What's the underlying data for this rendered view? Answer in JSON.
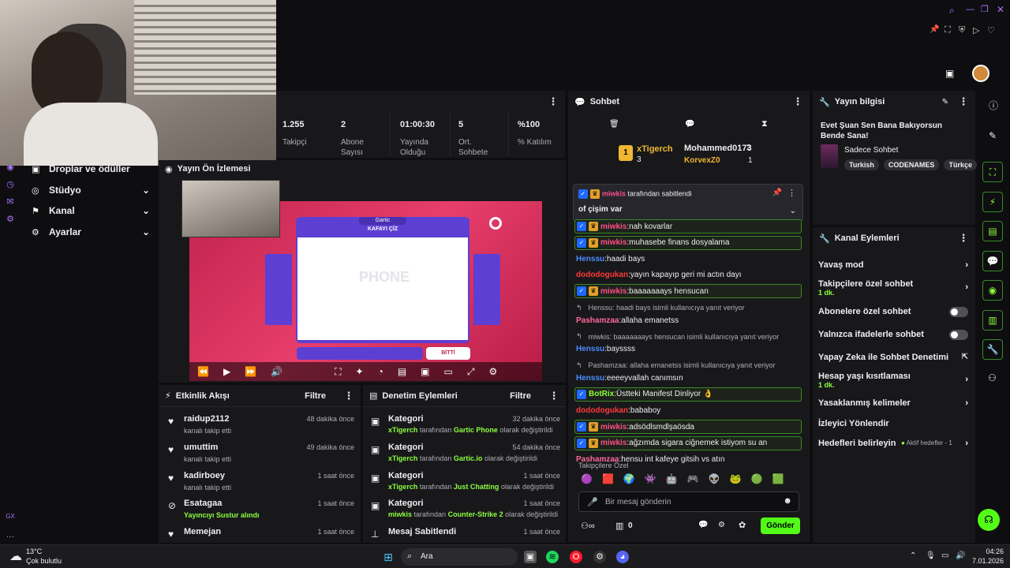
{
  "stats": [
    {
      "value": "1.255",
      "label": "Takipçi"
    },
    {
      "value": "2",
      "label": "Abone Sayısı"
    },
    {
      "value": "01:00:30",
      "label": "Yayında Olduğu"
    },
    {
      "value": "5",
      "label": "Ort. Sohbete"
    },
    {
      "value": "%100",
      "label": "% Katılım"
    }
  ],
  "nav": {
    "drops": "Droplar ve ödüller",
    "studio": "Stüdyo",
    "channel": "Kanal",
    "settings": "Ayarlar",
    "gx": "GX"
  },
  "preview": {
    "title": "Yayın Ön İzlemesi",
    "game_title": "KAFAYI ÇİZ",
    "game_brand": "Gartic",
    "game_logo": "PHONE",
    "done_btn": "BİTTİ"
  },
  "activity": {
    "title": "Etkinlik Akışı",
    "filter": "Filtre",
    "items": [
      {
        "name": "raidup2112",
        "sub": "kanalı takip etti",
        "time": "48 dakika önce"
      },
      {
        "name": "umuttim",
        "sub": "kanalı takip etti",
        "time": "49 dakika önce"
      },
      {
        "name": "kadirboey",
        "sub": "kanalı takip etti",
        "time": "1 saat önce"
      },
      {
        "name": "Esatagaa",
        "sub": "Yayıncıyı Sustur alındı",
        "time": "1 saat önce"
      },
      {
        "name": "Memejan",
        "sub": "",
        "time": "1 saat önce"
      }
    ]
  },
  "mod": {
    "title": "Denetim Eylemleri",
    "filter": "Filtre",
    "items": [
      {
        "name": "Kategori",
        "who": "xTigerch",
        "mid": "tarafından",
        "what": "Gartic Phone",
        "end": "olarak değiştirildi",
        "time": "32 dakika önce"
      },
      {
        "name": "Kategori",
        "who": "xTigerch",
        "mid": "tarafından",
        "what": "Gartic.io",
        "end": "olarak değiştirildi",
        "time": "54 dakika önce"
      },
      {
        "name": "Kategori",
        "who": "xTigerch",
        "mid": "tarafından",
        "what": "Just Chatting",
        "end": "olarak değiştirildi",
        "time": "1 saat önce"
      },
      {
        "name": "Kategori",
        "who": "miwkis",
        "mid": "tarafından",
        "what": "Counter-Strike 2",
        "end": "olarak değiştirildi",
        "time": "1 saat önce"
      },
      {
        "name": "Mesaj Sabitlendi",
        "who": "",
        "mid": "",
        "what": "",
        "end": "",
        "time": "1 saat önce"
      }
    ]
  },
  "chat": {
    "title": "Sohbet",
    "lb": [
      {
        "rank": "1",
        "name": "xTigerch",
        "count": "3"
      },
      {
        "name": "Mohammed0173",
        "count": "2"
      },
      {
        "name": "KorvexZ0",
        "count": "1"
      }
    ],
    "pinned_by": "miwkis",
    "pinned_suffix": "tarafından sabitlendi",
    "pinned_text": "of çişim var",
    "followers_only": "Takipçilere Özel",
    "input_placeholder": "Bir mesaj gönderin",
    "send": "Gönder",
    "points": "0",
    "messages": [
      {
        "user": "miwkis",
        "text": "nah kovarlar",
        "style": "miw",
        "hl": true
      },
      {
        "user": "miwkis",
        "text": "muhasebe finans dosyalama",
        "style": "miw",
        "hl": true
      },
      {
        "user": "Henssu",
        "text": "haadi bays",
        "style": "blue",
        "hl": false
      },
      {
        "user": "dododogukan",
        "text": "yayın kapayıp geri mi actın dayı",
        "style": "red",
        "hl": false
      },
      {
        "user": "miwkis",
        "text": "baaaaaaays hensucan",
        "style": "miw",
        "hl": true
      },
      {
        "reply": "Henssu: haadi bays isimli kullanıcıya yanıt veriyor"
      },
      {
        "user": "Pashamzaa",
        "text": "allaha emanetss",
        "style": "pink",
        "hl": false
      },
      {
        "reply": "miwkis: baaaaaaays hensucan isimli kullanıcıya yanıt veriyor"
      },
      {
        "user": "Henssu",
        "text": "bayssss",
        "style": "blue",
        "hl": false
      },
      {
        "reply": "Pashamzaa: allaha emanetss isimli kullanıcıya yanıt veriyor"
      },
      {
        "user": "Henssu",
        "text": "eeeeyvallah canımsın",
        "style": "blue",
        "hl": false
      },
      {
        "user": "BotRix",
        "text": "Üstteki Manifest Dinliyor 👌",
        "style": "green",
        "hl": true
      },
      {
        "user": "dododogukan",
        "text": "bababoy",
        "style": "red",
        "hl": false
      },
      {
        "user": "miwkis",
        "text": "adsödlsmdlşaösda",
        "style": "miw",
        "hl": true
      },
      {
        "user": "miwkis",
        "text": "ağzımda sigara ciğnemek istiyom su an",
        "style": "miw",
        "hl": true
      },
      {
        "user": "Pashamzaa",
        "text": "hensu int kafeye gitsih vs atın",
        "style": "pink",
        "hl": false
      }
    ]
  },
  "info": {
    "title": "Yayın bilgisi",
    "stream_title": "Evet Şuan Sen Bana Bakıyorsun Bende Sana!",
    "category": "Sadece Sohbet",
    "tags": [
      "Turkish",
      "CODENAMES",
      "Türkçe"
    ]
  },
  "channel_actions": {
    "title": "Kanal Eylemleri",
    "items": [
      {
        "label": "Yavaş mod",
        "sub": "",
        "ctl": "chev"
      },
      {
        "label": "Takipçilere özel sohbet",
        "sub": "1 dk.",
        "ctl": "chev"
      },
      {
        "label": "Abonelere özel sohbet",
        "sub": "",
        "ctl": "toggle"
      },
      {
        "label": "Yalnızca ifadelerle sohbet",
        "sub": "",
        "ctl": "toggle"
      },
      {
        "label": "Yapay Zeka ile Sohbet Denetimi",
        "sub": "",
        "ctl": "ext"
      },
      {
        "label": "Hesap yaşı kısıtlaması",
        "sub": "1 dk.",
        "ctl": "chev"
      },
      {
        "label": "Yasaklanmış kelimeler",
        "sub": "",
        "ctl": "chev"
      },
      {
        "label": "İzleyici Yönlendir",
        "sub": "",
        "ctl": ""
      },
      {
        "label": "Hedefleri belirleyin",
        "sub": "",
        "ctl": "chev",
        "extra": "Aktif hedefler - 1"
      }
    ]
  },
  "taskbar": {
    "weather_temp": "13°C",
    "weather_desc": "Çok bulutlu",
    "search": "Ara",
    "time": "04:26",
    "date": "7.01.2026"
  },
  "colors": {
    "accent": "#8cff3f",
    "bg": "#0e0e10",
    "panel": "#18181b"
  }
}
